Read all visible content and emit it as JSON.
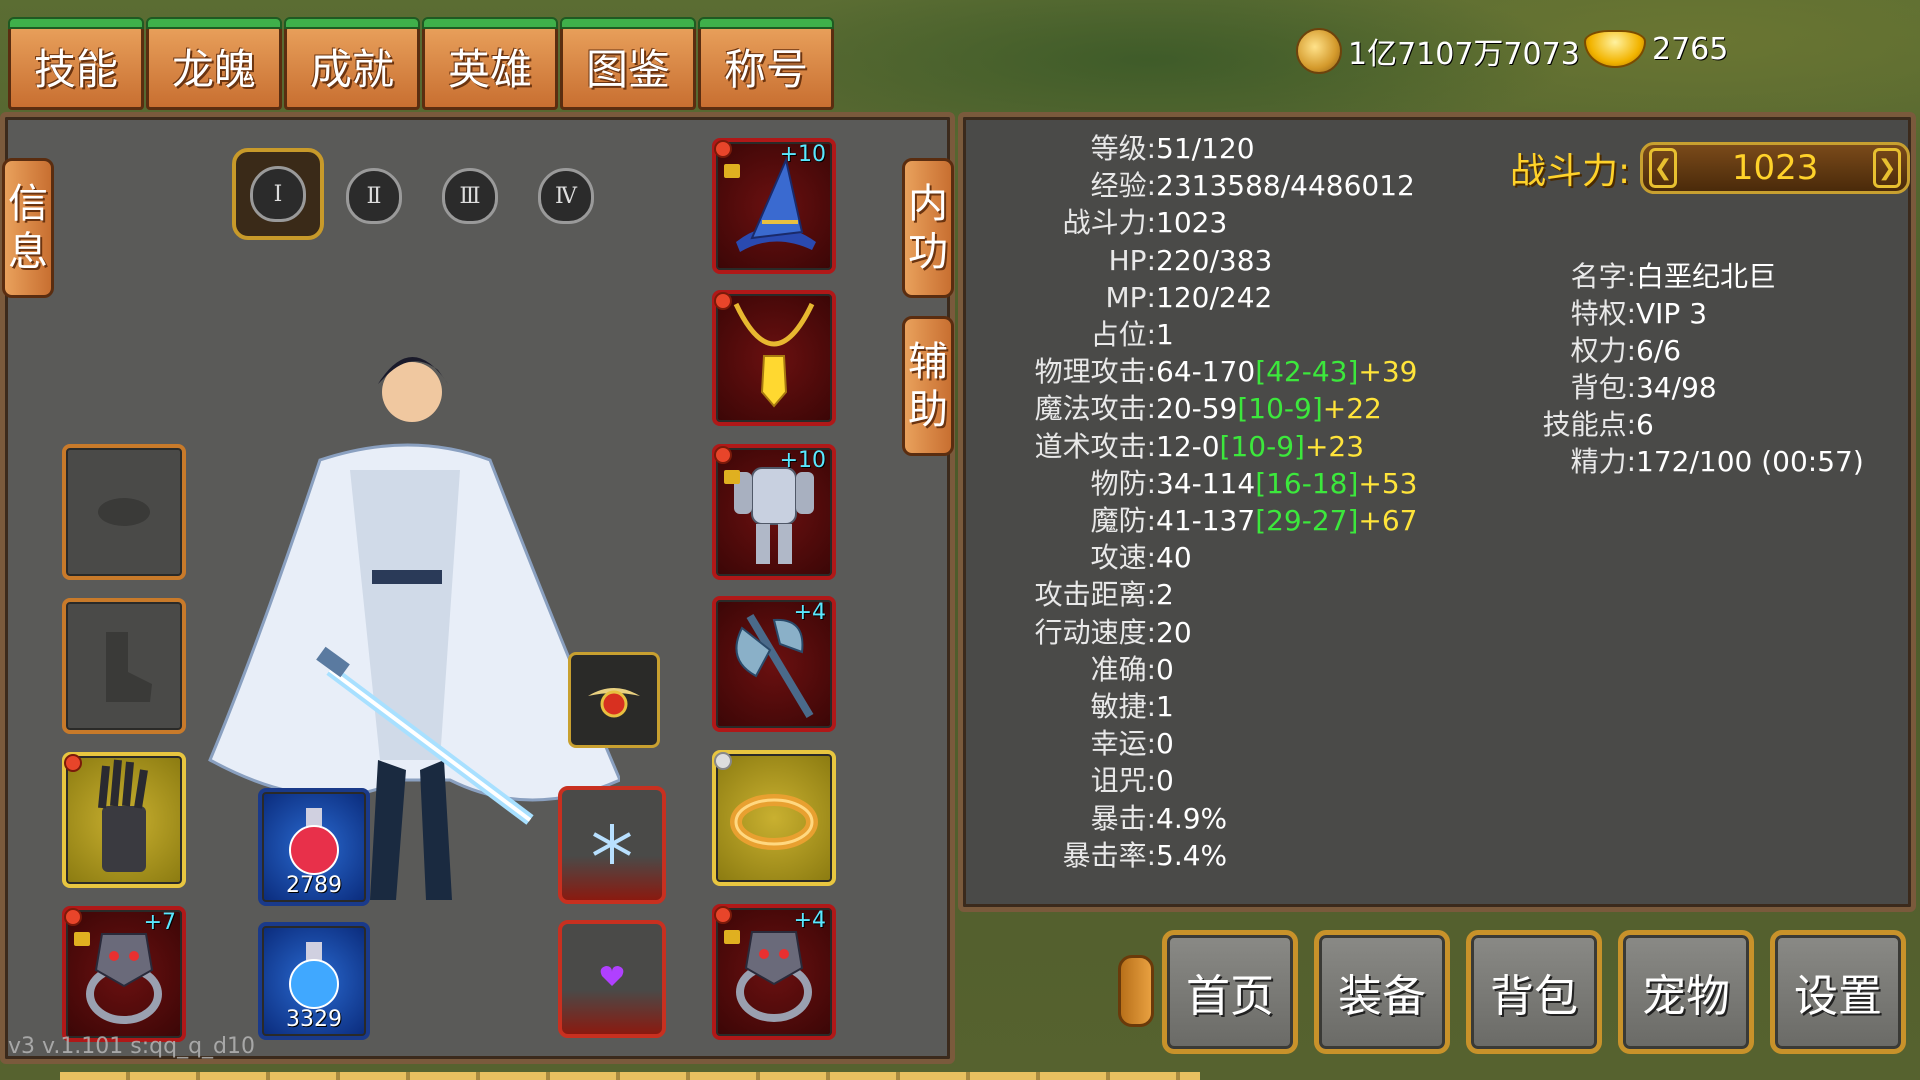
{
  "tabs": [
    "技能",
    "龙魄",
    "成就",
    "英雄",
    "图鉴",
    "称号"
  ],
  "currency": {
    "coins": "1亿7107万7073",
    "ingots": "2765"
  },
  "side_tabs": {
    "info": [
      "信",
      "息"
    ],
    "neigong": [
      "内",
      "功"
    ],
    "fuzhu": [
      "辅",
      "助"
    ]
  },
  "ranks": [
    "Ⅰ",
    "Ⅱ",
    "Ⅲ",
    "Ⅳ"
  ],
  "equipment": {
    "hat_plus": "+10",
    "armor_plus": "+10",
    "weapon_plus": "+4",
    "ring_left_plus": "+7",
    "ring_right_plus": "+4"
  },
  "potions": {
    "hp_count": "2789",
    "mp_count": "3329"
  },
  "stats": [
    {
      "label": "等级:",
      "value": "51/120"
    },
    {
      "label": "经验:",
      "value": "2313588/4486012"
    },
    {
      "label": "战斗力:",
      "value": "1023"
    },
    {
      "label": "HP:",
      "value": "220/383"
    },
    {
      "label": "MP:",
      "value": "120/242"
    },
    {
      "label": "占位:",
      "value": "1"
    },
    {
      "label": "物理攻击:",
      "value": "64-170",
      "bonus": "[42-43]",
      "extra": "+39"
    },
    {
      "label": "魔法攻击:",
      "value": "20-59",
      "bonus": "[10-9]",
      "extra": "+22"
    },
    {
      "label": "道术攻击:",
      "value": "12-0",
      "bonus": "[10-9]",
      "extra": "+23"
    },
    {
      "label": "物防:",
      "value": "34-114",
      "bonus": "[16-18]",
      "extra": "+53"
    },
    {
      "label": "魔防:",
      "value": "41-137",
      "bonus": "[29-27]",
      "extra": "+67"
    },
    {
      "label": "攻速:",
      "value": "40"
    },
    {
      "label": "攻击距离:",
      "value": "2"
    },
    {
      "label": "行动速度:",
      "value": "20"
    },
    {
      "label": "准确:",
      "value": "0"
    },
    {
      "label": "敏捷:",
      "value": "1"
    },
    {
      "label": "幸运:",
      "value": "0"
    },
    {
      "label": "诅咒:",
      "value": "0"
    },
    {
      "label": "暴击:",
      "value": "4.9%"
    },
    {
      "label": "暴击率:",
      "value": "5.4%"
    }
  ],
  "power": {
    "label": "战斗力:",
    "value": "1023"
  },
  "info": [
    {
      "label": "名字:",
      "value": " 白垩纪北巨"
    },
    {
      "label": "特权:",
      "value": "VIP 3"
    },
    {
      "label": "权力:",
      "value": "6/6"
    },
    {
      "label": "背包:",
      "value": "34/98"
    },
    {
      "label": "技能点:",
      "value": "6"
    },
    {
      "label": "精力:",
      "value": "172/100 (00:57)"
    }
  ],
  "bottom_buttons": [
    "首页",
    "装备",
    "背包",
    "宠物",
    "设置"
  ],
  "version": "v3 v.1.101 s:qq_q_d10",
  "colors": {
    "bonus": "#3ce83c",
    "extra": "#ffe43a",
    "power": "#ffd22a"
  }
}
